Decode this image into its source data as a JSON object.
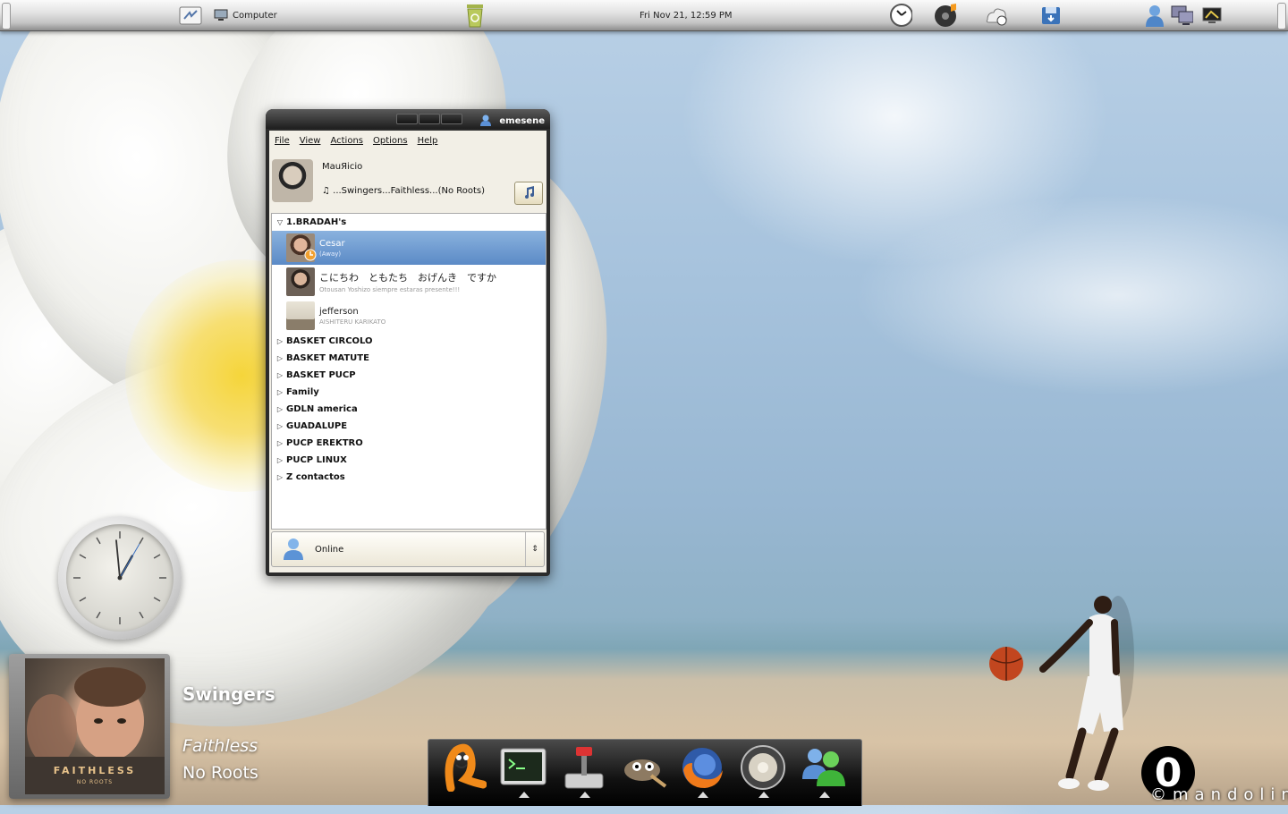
{
  "top_panel": {
    "computer_label": "Computer",
    "clock": "Fri Nov 21, 12:59 PM",
    "icons": [
      "home-folder-icon",
      "computer-icon",
      "trash-icon",
      "timer-icon",
      "music-player-icon",
      "weather-icon",
      "floppy-save-icon",
      "user-icon",
      "network-icon",
      "display-icon"
    ]
  },
  "window": {
    "title": "emesene",
    "menu": [
      "File",
      "View",
      "Actions",
      "Options",
      "Help"
    ],
    "profile": {
      "nick": "MauЯicio",
      "personal_message": "♫ ...Swingers...Faithless...(No Roots)"
    },
    "groups": [
      {
        "name": "1.BRADAH's",
        "expanded": true,
        "contacts": [
          {
            "name": "Cesar",
            "message": "(Away)",
            "selected": true
          },
          {
            "name": "こにちわ　ともたち　おげんき　ですか",
            "message": "Otousan Yoshizo siempre estaras presente!!!",
            "selected": false
          },
          {
            "name": "jefferson",
            "message": "AISHITERU KARIKATO",
            "selected": false
          }
        ]
      },
      {
        "name": "BASKET CIRCOLO",
        "expanded": false
      },
      {
        "name": "BASKET MATUTE",
        "expanded": false
      },
      {
        "name": "BASKET PUCP",
        "expanded": false
      },
      {
        "name": "Family",
        "expanded": false
      },
      {
        "name": "GDLN america",
        "expanded": false
      },
      {
        "name": "GUADALUPE",
        "expanded": false
      },
      {
        "name": "PUCP EREKTRO",
        "expanded": false
      },
      {
        "name": "PUCP LINUX",
        "expanded": false
      },
      {
        "name": "Z contactos",
        "expanded": false
      }
    ],
    "status": "Online"
  },
  "now_playing": {
    "title": "Swingers",
    "artist": "Faithless",
    "album": "No Roots",
    "cover_band": "FAITHLESS",
    "cover_album": "NO ROOTS"
  },
  "clock_desklet": {
    "hour": 12,
    "minute": 59,
    "second": 5
  },
  "dock": {
    "items": [
      "tomboy-icon",
      "terminal-icon",
      "joystick-icon",
      "gimp-icon",
      "firefox-icon",
      "speaker-icon",
      "messenger-icon"
    ],
    "running": [
      "terminal-icon",
      "joystick-icon",
      "firefox-icon",
      "speaker-icon",
      "messenger-icon"
    ]
  },
  "desktop": {
    "score": "0",
    "watermark": "©mandolin"
  }
}
